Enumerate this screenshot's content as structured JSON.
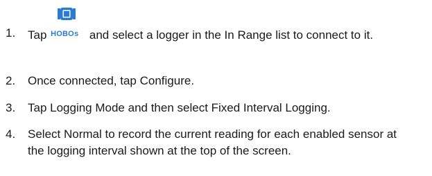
{
  "steps": [
    {
      "number": "1.",
      "before_icon": "Tap ",
      "icon": {
        "name": "hobos-logger-icon",
        "label": "HOBOs",
        "color": "#2b7bd0"
      },
      "after_icon": " and select a logger in the In Range list to connect to it."
    },
    {
      "number": "2.",
      "text": "Once connected, tap Configure."
    },
    {
      "number": "3.",
      "text": "Tap Logging Mode and then select Fixed Interval Logging."
    },
    {
      "number": "4.",
      "text": "Select Normal to record the current reading for each enabled sensor at the logging interval shown at the top of the screen."
    }
  ]
}
